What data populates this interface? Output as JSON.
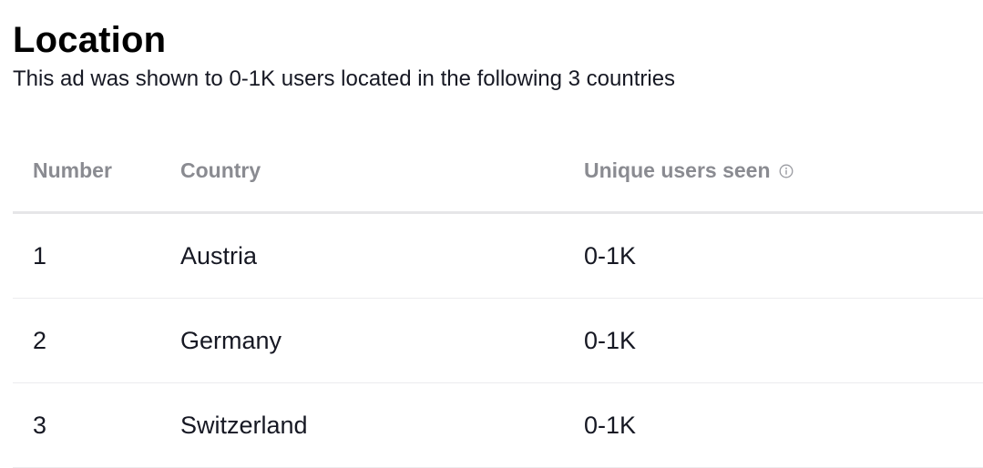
{
  "section": {
    "title": "Location",
    "subtitle": "This ad was shown to 0-1K users located in the following 3 countries"
  },
  "table": {
    "headers": {
      "number": "Number",
      "country": "Country",
      "unique_users": "Unique users seen",
      "unique_users_icon": "info-icon"
    },
    "rows": [
      {
        "number": "1",
        "country": "Austria",
        "unique_users": "0-1K"
      },
      {
        "number": "2",
        "country": "Germany",
        "unique_users": "0-1K"
      },
      {
        "number": "3",
        "country": "Switzerland",
        "unique_users": "0-1K"
      }
    ]
  },
  "colors": {
    "header_text": "#8a8b91",
    "body_text": "#161823",
    "divider": "#e6e6e8"
  }
}
